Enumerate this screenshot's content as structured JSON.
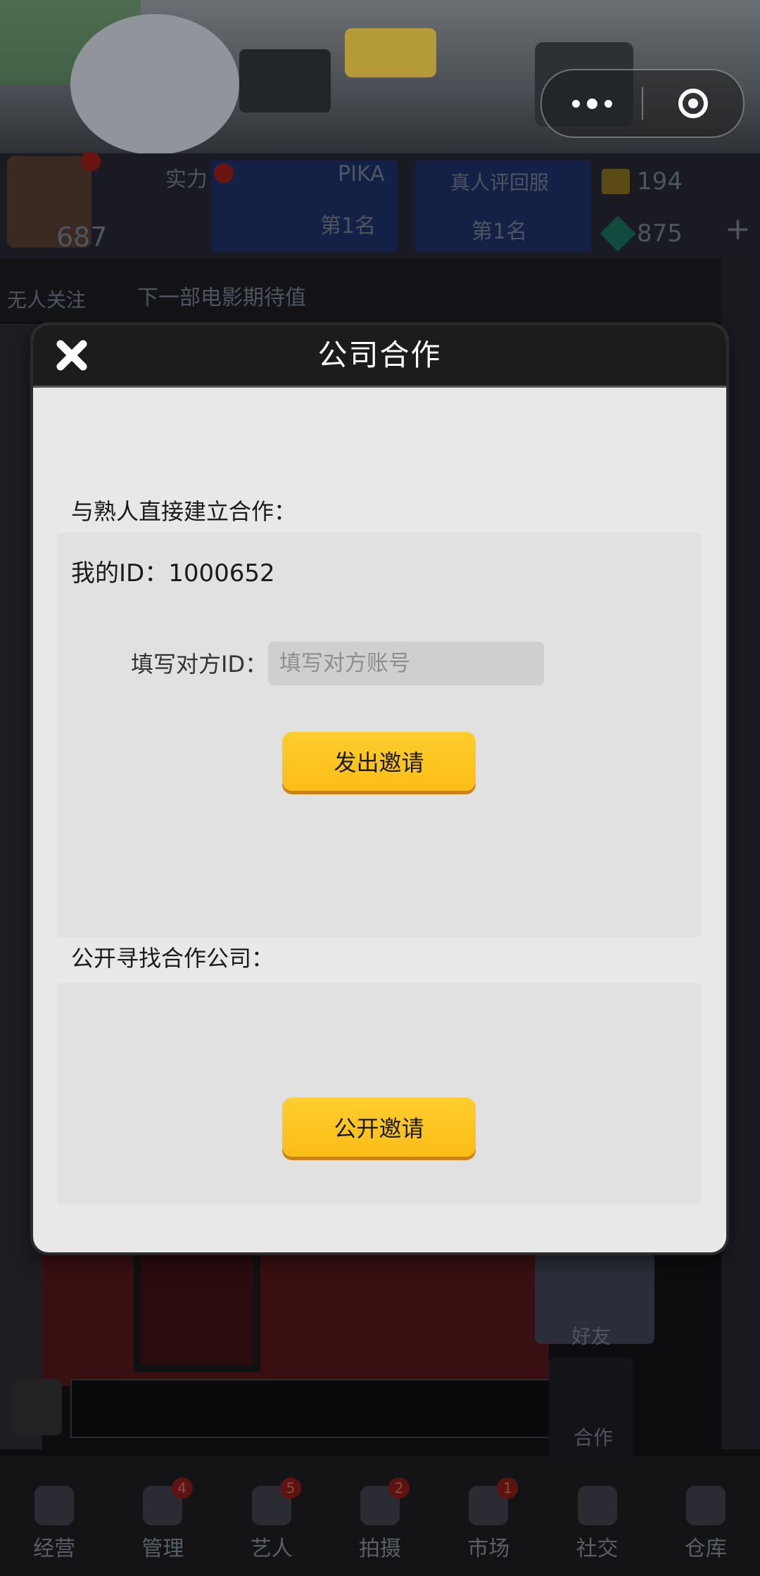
{
  "window": {
    "capsule": {
      "more_icon": "more-dots-icon",
      "close_icon": "target-close-icon"
    }
  },
  "background": {
    "strength_label": "实力",
    "player_score": "687",
    "rank_name": "PIKA",
    "rank_1": "第1名",
    "rank_2": "第1名",
    "rank_server": "真人评回服",
    "gold_value": "194",
    "diamond_value": "875",
    "follow_label": "无人关注",
    "movie_status": "下一部电影期待值",
    "bottom_nav": [
      {
        "label": "经营",
        "badge": ""
      },
      {
        "label": "管理",
        "badge": "4"
      },
      {
        "label": "艺人",
        "badge": "5"
      },
      {
        "label": "拍摄",
        "badge": "2"
      },
      {
        "label": "市场",
        "badge": "1"
      },
      {
        "label": "社交",
        "badge": ""
      },
      {
        "label": "仓库",
        "badge": ""
      }
    ],
    "side_labels": {
      "friends": "好友",
      "cooperation": "合作"
    }
  },
  "modal": {
    "title": "公司合作",
    "direct_section": {
      "label": "与熟人直接建立合作：",
      "my_id_label": "我的ID：",
      "my_id_value": "1000652",
      "target_label": "填写对方ID：",
      "target_placeholder": "填写对方账号",
      "target_value": "",
      "invite_button": "发出邀请"
    },
    "public_section": {
      "label": "公开寻找合作公司：",
      "public_button": "公开邀请"
    }
  },
  "colors": {
    "button_yellow": "#fbbd16",
    "header_dark": "#1c1c1c",
    "modal_bg": "#e8e8e8"
  }
}
